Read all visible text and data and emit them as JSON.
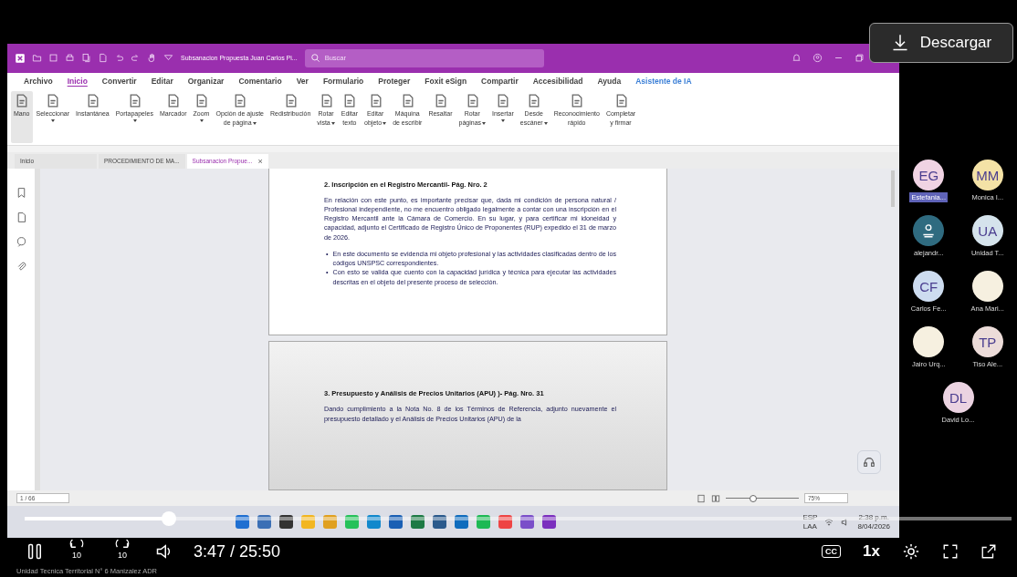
{
  "app": {
    "title": "Subsanacion Propuesta Juan Carlos Pi...",
    "search": {
      "placeholder": "Buscar"
    },
    "menu": [
      {
        "label": "Archivo",
        "selected": false,
        "kind": "plain"
      },
      {
        "label": "Inicio",
        "selected": true,
        "kind": "plain"
      },
      {
        "label": "Convertir",
        "selected": false,
        "kind": "plain"
      },
      {
        "label": "Editar",
        "selected": false,
        "kind": "plain"
      },
      {
        "label": "Organizar",
        "selected": false,
        "kind": "plain"
      },
      {
        "label": "Comentario",
        "selected": false,
        "kind": "plain"
      },
      {
        "label": "Ver",
        "selected": false,
        "kind": "plain"
      },
      {
        "label": "Formulario",
        "selected": false,
        "kind": "plain"
      },
      {
        "label": "Proteger",
        "selected": false,
        "kind": "plain"
      },
      {
        "label": "Foxit eSign",
        "selected": false,
        "kind": "plain"
      },
      {
        "label": "Compartir",
        "selected": false,
        "kind": "plain"
      },
      {
        "label": "Accesibilidad",
        "selected": false,
        "kind": "plain"
      },
      {
        "label": "Ayuda",
        "selected": false,
        "kind": "plain"
      },
      {
        "label": "Asistente de IA",
        "selected": false,
        "kind": "ai"
      }
    ],
    "ribbon": [
      {
        "lines": [
          "Mano"
        ],
        "selected": true,
        "dropdown": false
      },
      {
        "lines": [
          "Seleccionar"
        ],
        "selected": false,
        "dropdown": true
      },
      {
        "lines": [
          "Instantánea"
        ],
        "selected": false,
        "dropdown": false
      },
      {
        "lines": [
          "Portapapeles"
        ],
        "selected": false,
        "dropdown": true
      },
      {
        "lines": [
          "Marcador"
        ],
        "selected": false,
        "dropdown": false
      },
      {
        "lines": [
          "Zoom"
        ],
        "selected": false,
        "dropdown": true
      },
      {
        "lines": [
          "Opción de ajuste",
          "de página"
        ],
        "selected": false,
        "dropdown": true
      },
      {
        "lines": [
          "Redistribución"
        ],
        "selected": false,
        "dropdown": false
      },
      {
        "lines": [
          "Rotar",
          "vista"
        ],
        "selected": false,
        "dropdown": true
      },
      {
        "lines": [
          "Editar",
          "texto"
        ],
        "selected": false,
        "dropdown": false
      },
      {
        "lines": [
          "Editar",
          "objeto"
        ],
        "selected": false,
        "dropdown": true
      },
      {
        "lines": [
          "Máquina",
          "de escribir"
        ],
        "selected": false,
        "dropdown": false
      },
      {
        "lines": [
          "Resaltar"
        ],
        "selected": false,
        "dropdown": false
      },
      {
        "lines": [
          "Rotar",
          "páginas"
        ],
        "selected": false,
        "dropdown": true
      },
      {
        "lines": [
          "Insertar"
        ],
        "selected": false,
        "dropdown": true
      },
      {
        "lines": [
          "Desde",
          "escáner"
        ],
        "selected": false,
        "dropdown": true
      },
      {
        "lines": [
          "Reconocimiento",
          "rápido"
        ],
        "selected": false,
        "dropdown": false
      },
      {
        "lines": [
          "Completar",
          "y firmar"
        ],
        "selected": false,
        "dropdown": false
      }
    ],
    "tabs": [
      {
        "label": "Inicio",
        "selected": false,
        "closable": false
      },
      {
        "label": "PROCEDIMIENTO DE MA...",
        "selected": false,
        "closable": false
      },
      {
        "label": "Subsanacion Propue...",
        "selected": true,
        "closable": true
      }
    ],
    "close_glyph": "×",
    "document": {
      "pages": [
        {
          "heading": "2. Inscripción en el Registro Mercantil- Pág. Nro. 2",
          "paragraph": "En relación con este punto, es importante precisar que, dada mi condición de persona natural / Profesional independiente, no me encuentro obligado legalmente a contar con una inscripción en el Registro Mercantil ante la Cámara de Comercio. En su lugar, y para certificar mi idoneidad y capacidad, adjunto el Certificado de Registro Único de Proponentes (RUP) expedido el 31 de marzo de 2026.",
          "bullets": [
            "En este documento se evidencia mi objeto profesional y las actividades clasificadas dentro de los códigos UNSPSC correspondientes.",
            "Con esto se valida que cuento con la capacidad jurídica y técnica para ejecutar las actividades descritas en el objeto del presente proceso de selección."
          ]
        },
        {
          "heading": "3. Presupuesto y Análisis de Precios Unitarios (APU) )- Pág. Nro. 31",
          "paragraph": "Dando cumplimiento a la Nota No. 8 de los Términos de Referencia, adjunto nuevamente el presupuesto detallado y el Análisis de Precios Unitarios (APU) de la"
        }
      ],
      "bullet_marker": "•"
    },
    "status": {
      "page": "1 / 66",
      "zoom": "75%",
      "zoom_slider": {
        "level": 0.38
      }
    },
    "taskbar": {
      "language": "ESP",
      "layout": "LAA",
      "time": "2:38 p.m.",
      "date": "8/04/2026"
    }
  },
  "participants": [
    {
      "initials": "EG",
      "name": "Estefania...",
      "kind": "initials",
      "color": "#f0d3e3",
      "selected": true
    },
    {
      "initials": "MM",
      "name": "Monica I...",
      "kind": "initials",
      "color": "#f4e2a6",
      "selected": false
    },
    {
      "name": "alejandr...",
      "kind": "icon",
      "color": "#2f6b80",
      "selected": false
    },
    {
      "initials": "UA",
      "name": "Unidad T...",
      "kind": "initials",
      "color": "#d5e3ec",
      "selected": false
    },
    {
      "initials": "CF",
      "name": "Carlos Fe...",
      "kind": "initials",
      "color": "#cddcf0",
      "selected": false
    },
    {
      "name": "Ana Mari...",
      "kind": "photo",
      "color": "#f6f0e0",
      "selected": false
    },
    {
      "name": "Jairo Urq...",
      "kind": "photo",
      "color": "#f6f0e0",
      "selected": false
    },
    {
      "initials": "TP",
      "name": "Tiso Ale...",
      "kind": "initials",
      "color": "#ecdcd9",
      "selected": false
    },
    {
      "initials": "DL",
      "name": "David Lo...",
      "kind": "initials",
      "color": "#ebd3e1",
      "selected": false
    }
  ],
  "player": {
    "download": "Descargar",
    "progress": {
      "level": 0.146
    },
    "skip_back": "10",
    "skip_forward": "10",
    "time": "3:47 / 25:50",
    "captions": "CC",
    "speed": "1x",
    "caption": "Unidad Tecnica Territorial N° 6 Manizalez ADR"
  }
}
